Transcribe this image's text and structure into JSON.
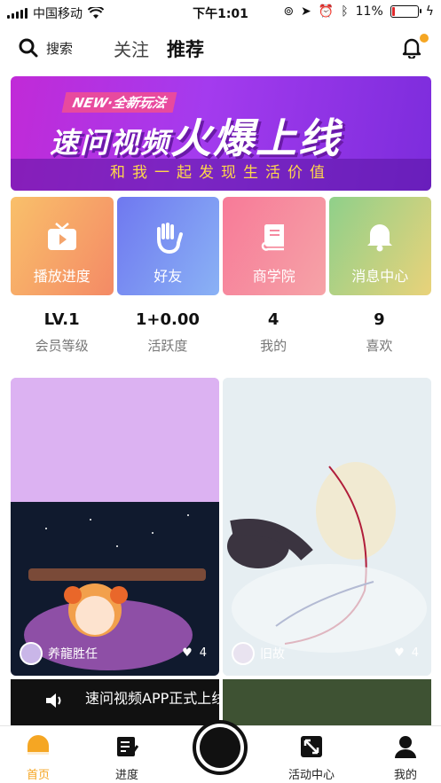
{
  "status": {
    "carrier": "中国移动",
    "time": "下午1:01",
    "battery": "11%",
    "battery_level": 0.11
  },
  "header": {
    "search_label": "搜索",
    "tabs": [
      {
        "label": "关注"
      },
      {
        "label": "推荐"
      }
    ]
  },
  "banner": {
    "tag": "NEW·全新玩法",
    "headline_small": "速问视频",
    "headline_big": "火爆上线",
    "subtitle": "和我一起发现生活价值"
  },
  "tiles": [
    {
      "label": "播放进度",
      "icon": "play-icon"
    },
    {
      "label": "好友",
      "icon": "hand-icon"
    },
    {
      "label": "商学院",
      "icon": "book-icon"
    },
    {
      "label": "消息中心",
      "icon": "bell-icon"
    }
  ],
  "stats": [
    {
      "value": "LV.1",
      "label": "会员等级"
    },
    {
      "value": "1+0.00",
      "label": "活跃度"
    },
    {
      "value": "4",
      "label": "我的"
    },
    {
      "value": "9",
      "label": "喜欢"
    }
  ],
  "feed": [
    {
      "author": "养龍胜任",
      "likes": "4"
    },
    {
      "author": "旧故",
      "likes": "4"
    }
  ],
  "notice": {
    "text": "速问视频APP正式上线!"
  },
  "nav": [
    {
      "label": "首页",
      "icon": "home-icon"
    },
    {
      "label": "进度",
      "icon": "progress-icon"
    },
    {
      "label": "活动中心",
      "icon": "activity-icon"
    },
    {
      "label": "我的",
      "icon": "user-icon"
    }
  ],
  "colors": {
    "accent": "#f5a623",
    "banner_purple": "#a43bee",
    "banner_yellow": "#ffd84a"
  }
}
